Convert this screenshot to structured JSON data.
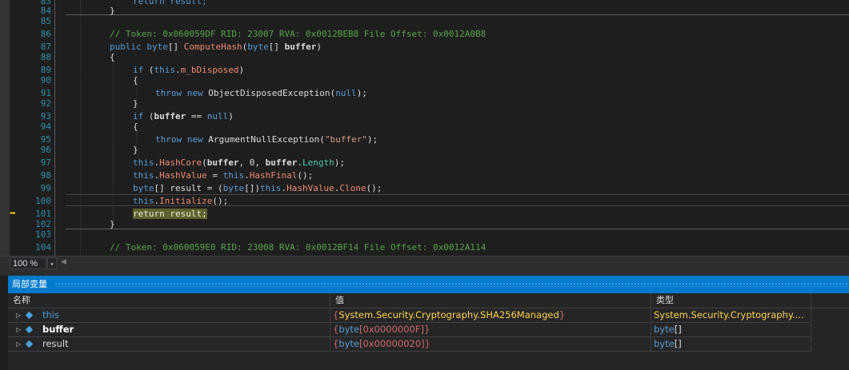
{
  "editor": {
    "line_numbers": [
      "83",
      "84",
      "85",
      "86",
      "87",
      "88",
      "89",
      "90",
      "91",
      "92",
      "93",
      "94",
      "95",
      "96",
      "97",
      "98",
      "99",
      "100",
      "101",
      "102",
      "103",
      "104"
    ],
    "lines": {
      "l83": "return result;",
      "l84": "}",
      "l86": "// Token: 0x060059DF RID: 23007 RVA: 0x0012BEB8 File Offset: 0x0012A0B8",
      "l87_kw1": "public",
      "l87_kw2": "byte",
      "l87_arr": "[] ",
      "l87_fn": "ComputeHash",
      "l87_p1": "(",
      "l87_kw3": "byte",
      "l87_p2": "[] ",
      "l87_param": "buffer",
      "l87_p3": ")",
      "l88": "{",
      "l89_if": "if",
      "l89_p": " (",
      "l89_this": "this",
      "l89_dot": ".",
      "l89_field": "m_bDisposed",
      "l89_end": ")",
      "l90": "{",
      "l91_throw": "throw new",
      "l91_rest": " ObjectDisposedException(",
      "l91_null": "null",
      "l91_end": ");",
      "l92": "}",
      "l93_if": "if",
      "l93_p": " (",
      "l93_param": "buffer",
      "l93_op": " == ",
      "l93_null": "null",
      "l93_end": ")",
      "l94": "{",
      "l95_throw": "throw new",
      "l95_rest": " ArgumentNullException(",
      "l95_str": "\"buffer\"",
      "l95_end": ");",
      "l96": "}",
      "l97_this": "this",
      "l97_dot": ".",
      "l97_fn": "HashCore",
      "l97_p1": "(",
      "l97_b1": "buffer",
      "l97_mid": ", 0, ",
      "l97_b2": "buffer",
      "l97_dot2": ".",
      "l97_prop": "Length",
      "l97_end": ");",
      "l98_this": "this",
      "l98_dot": ".",
      "l98_field": "HashValue",
      "l98_eq": " = ",
      "l98_this2": "this",
      "l98_dot2": ".",
      "l98_fn": "HashFinal",
      "l98_end": "();",
      "l99_kw": "byte",
      "l99_a": "[] result = (",
      "l99_kw2": "byte",
      "l99_b": "[])",
      "l99_this": "this",
      "l99_dot": ".",
      "l99_field": "HashValue",
      "l99_dot2": ".",
      "l99_fn": "Clone",
      "l99_end": "();",
      "l100_this": "this",
      "l100_dot": ".",
      "l100_fn": "Initialize",
      "l100_end": "();",
      "l101": "return result;",
      "l102": "}",
      "l104": "// Token: 0x060059E0 RID: 23008 RVA: 0x0012BF14 File Offset: 0x0012A114"
    },
    "current_line_arrow": "➡"
  },
  "zoom": {
    "value": "100 %",
    "dropdown": "▾",
    "scroll_left": "◀"
  },
  "locals": {
    "title": "局部变量",
    "columns": {
      "name": "名称",
      "value": "值",
      "type": "类型"
    },
    "rows": [
      {
        "expander": "▷",
        "name": "this",
        "value_ns": "System.Security.Cryptography.",
        "value_type": "SHA256Managed",
        "type": "System.Security.Cryptography...."
      },
      {
        "expander": "▷",
        "name": "buffer",
        "value_kw": "byte",
        "value_rest": "[0x0000000F]",
        "type_kw": "byte",
        "type_rest": "[]"
      },
      {
        "expander": "▷",
        "name": "result",
        "value_kw": "byte",
        "value_rest": "[0x00000020]",
        "type_kw": "byte",
        "type_rest": "[]"
      }
    ],
    "brace_open": "{",
    "brace_close": "}"
  },
  "colors": {
    "accent": "#007acc",
    "editor_bg": "#1e1e1e",
    "keyword": "#569cd6",
    "comment": "#57a64a",
    "method": "#f08c70",
    "current_line_highlight": "#5f5f2f"
  }
}
